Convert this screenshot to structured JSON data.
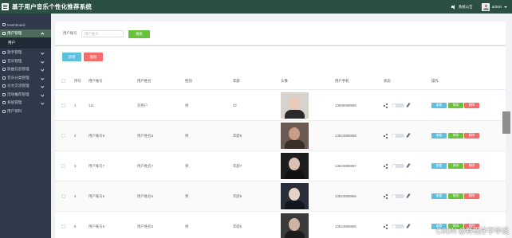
{
  "app": {
    "title": "基于用户音乐个性化推荐系统"
  },
  "topbar": {
    "notice_label": "系统公告",
    "user_name": "admin"
  },
  "sidebar": {
    "items": [
      {
        "label": "Dashboard",
        "active": false
      },
      {
        "label": "用户管理",
        "active": true,
        "expanded": true,
        "sub": [
          "用户"
        ]
      },
      {
        "label": "歌手管理",
        "active": false
      },
      {
        "label": "音乐管理",
        "active": false
      },
      {
        "label": "歌曲信息管理",
        "active": false
      },
      {
        "label": "音乐分类管理",
        "active": false
      },
      {
        "label": "论文交流管理",
        "active": false
      },
      {
        "label": "活动推荐管理",
        "active": false
      },
      {
        "label": "系统管理",
        "active": false
      },
      {
        "label": "用户资料",
        "active": false
      }
    ]
  },
  "search": {
    "label": "用户账号",
    "placeholder": "用户账号",
    "button_label": "搜索"
  },
  "toolbar": {
    "add_label": "新增",
    "delete_label": "删除"
  },
  "table": {
    "columns": [
      "序号",
      "用户账号",
      "用户姓名",
      "性别",
      "年龄",
      "头像",
      "用户手机",
      "状态",
      "操作"
    ],
    "action_labels": {
      "view": "查看",
      "edit": "修改",
      "delete": "删除"
    },
    "rows": [
      {
        "index": "1",
        "account": "111",
        "name": "刘用户",
        "gender": "男",
        "age": "22",
        "phone": "13899999999"
      },
      {
        "index": "2",
        "account": "用户账号8",
        "name": "用户姓名8",
        "gender": "男",
        "age": "年龄8",
        "phone": "13823888888"
      },
      {
        "index": "3",
        "account": "用户账号7",
        "name": "用户姓名7",
        "gender": "男",
        "age": "年龄7",
        "phone": "13823888887"
      },
      {
        "index": "4",
        "account": "用户账号6",
        "name": "用户姓名6",
        "gender": "男",
        "age": "年龄6",
        "phone": "13823888886"
      },
      {
        "index": "5",
        "account": "用户账号5",
        "name": "用户姓名5",
        "gender": "男",
        "age": "年龄5",
        "phone": "13823888885"
      }
    ]
  },
  "watermark": "CSDN @新程序学毕设"
}
